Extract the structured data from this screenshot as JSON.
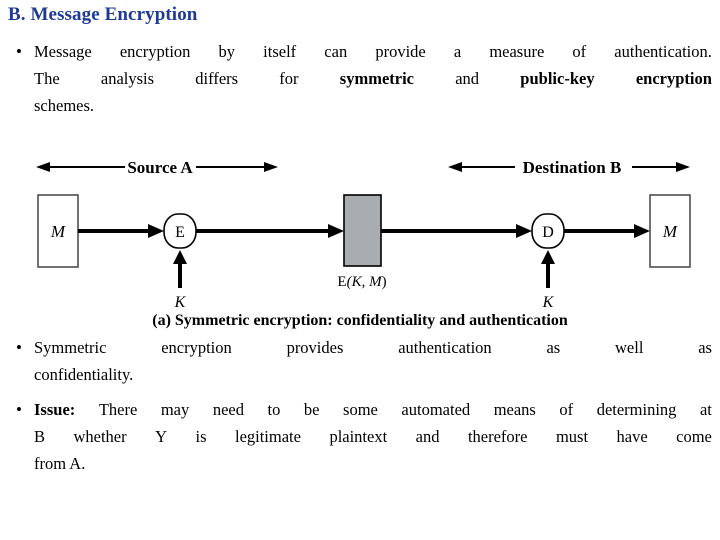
{
  "slide": {
    "title": "B. Message Encryption",
    "title_color": "#1F3A93",
    "background": "#FFFFFF"
  },
  "bullets": [
    {
      "marker": "•",
      "lines": [
        [
          {
            "text": "Message",
            "bold": false
          },
          {
            "text": "encryption",
            "bold": false
          },
          {
            "text": "by",
            "bold": false
          },
          {
            "text": "itself",
            "bold": false
          },
          {
            "text": "can",
            "bold": false
          },
          {
            "text": "provide",
            "bold": false
          },
          {
            "text": "a",
            "bold": false
          },
          {
            "text": "measure",
            "bold": false
          },
          {
            "text": "of",
            "bold": false
          },
          {
            "text": "authentication.",
            "bold": false
          }
        ],
        [
          {
            "text": "The",
            "bold": false
          },
          {
            "text": "analysis",
            "bold": false
          },
          {
            "text": "differs",
            "bold": false
          },
          {
            "text": "for",
            "bold": false
          },
          {
            "text": "symmetric",
            "bold": true
          },
          {
            "text": "and",
            "bold": false
          },
          {
            "text": "public-key",
            "bold": true
          },
          {
            "text": "encryption",
            "bold": true
          }
        ],
        [
          {
            "text": "schemes.",
            "bold": false
          }
        ]
      ],
      "plain_text": "Message encryption by itself can provide a measure of authentication. The analysis differs for symmetric and public-key encryption schemes."
    },
    {
      "marker": "•",
      "lines": [
        [
          {
            "text": "Symmetric",
            "bold": false
          },
          {
            "text": "encryption",
            "bold": false
          },
          {
            "text": "provides",
            "bold": false
          },
          {
            "text": "authentication",
            "bold": false
          },
          {
            "text": "as",
            "bold": false
          },
          {
            "text": "well",
            "bold": false
          },
          {
            "text": "as",
            "bold": false
          }
        ],
        [
          {
            "text": "confidentiality.",
            "bold": false
          }
        ]
      ],
      "plain_text": "Symmetric encryption provides authentication as well as confidentiality."
    },
    {
      "marker": "•",
      "lines": [
        [
          {
            "text": "Issue:",
            "bold": true
          },
          {
            "text": "There",
            "bold": false
          },
          {
            "text": "may",
            "bold": false
          },
          {
            "text": "need",
            "bold": false
          },
          {
            "text": "to",
            "bold": false
          },
          {
            "text": "be",
            "bold": false
          },
          {
            "text": "some",
            "bold": false
          },
          {
            "text": "automated",
            "bold": false
          },
          {
            "text": "means",
            "bold": false
          },
          {
            "text": "of",
            "bold": false
          },
          {
            "text": "determining",
            "bold": false
          },
          {
            "text": "at",
            "bold": false
          }
        ],
        [
          {
            "text": "B",
            "bold": false
          },
          {
            "text": "whether",
            "bold": false
          },
          {
            "text": "Y",
            "bold": false
          },
          {
            "text": "is",
            "bold": false
          },
          {
            "text": "legitimate",
            "bold": false
          },
          {
            "text": "plaintext",
            "bold": false
          },
          {
            "text": "and",
            "bold": false
          },
          {
            "text": "therefore",
            "bold": false
          },
          {
            "text": "must",
            "bold": false
          },
          {
            "text": "have",
            "bold": false
          },
          {
            "text": "come",
            "bold": false
          }
        ],
        [
          {
            "text": "from A.",
            "bold": false
          }
        ]
      ],
      "plain_text": "Issue: There may need to be some automated means of determining at B whether Y is legitimate plaintext and therefore must have come from A."
    }
  ],
  "diagram": {
    "caption": "(a) Symmetric encryption: confidentiality and authentication",
    "headers": {
      "source": "Source A",
      "destination": "Destination B"
    },
    "nodes": {
      "plaintext_in": "M",
      "encrypt": "E",
      "ciphertext": "E(K, M)",
      "ciphertext_plain": "E",
      "ciphertext_args": "(K, M)",
      "decrypt": "D",
      "plaintext_out": "M"
    },
    "keys": {
      "encrypt_key": "K",
      "decrypt_key": "K"
    },
    "colors": {
      "stroke": "#000000",
      "ciphertext_fill": "#AAADB0",
      "box_fill": "#FFFFFF",
      "box_stroke": "#444444"
    }
  }
}
